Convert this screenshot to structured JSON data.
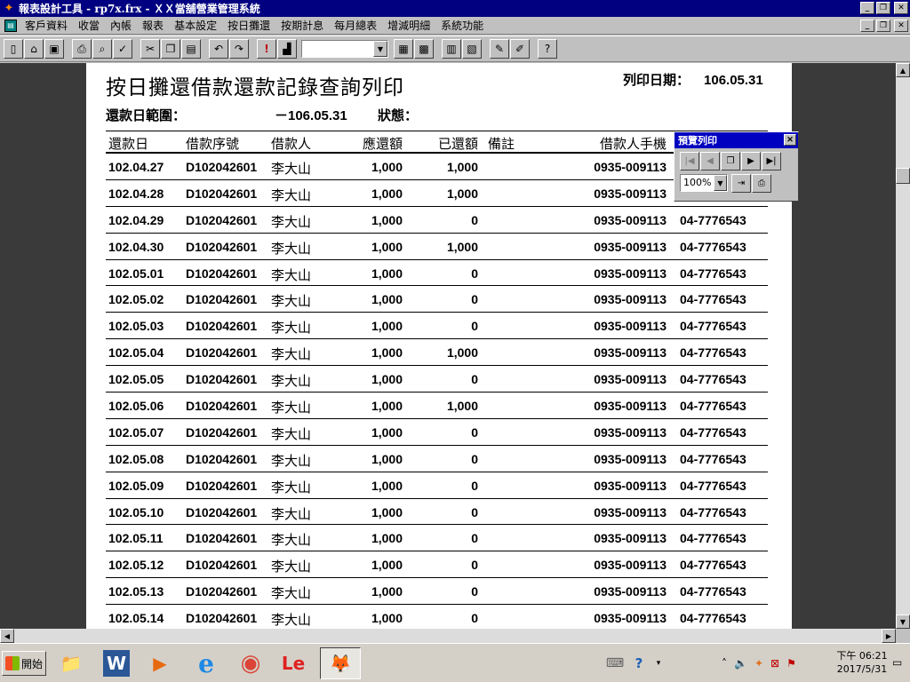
{
  "window": {
    "title": "報表設計工具 - rp7x.frx - ＸＸ當舖營業管理系統",
    "buttons": {
      "minimize": "_",
      "restore": "❐",
      "close": "✕"
    }
  },
  "menu": {
    "items": [
      "客戶資料",
      "收當",
      "內帳",
      "報表",
      "基本設定",
      "按日攤還",
      "按期計息",
      "每月總表",
      "增減明細",
      "系統功能"
    ]
  },
  "toolbar": {
    "icons": [
      "new-icon",
      "open-icon",
      "save-icon",
      "print-icon",
      "print-preview-icon",
      "spellcheck-icon",
      "cut-icon",
      "copy-icon",
      "paste-icon",
      "undo-icon",
      "redo-icon",
      "exclamation-icon",
      "chart-icon",
      "table-icon",
      "form-icon",
      "report-icon",
      "query-icon",
      "edit-icon",
      "wizard-icon",
      "help-icon"
    ],
    "combo_value": ""
  },
  "report": {
    "title": "按日攤還借款還款記錄查詢列印",
    "print_date_label": "列印日期：",
    "print_date": "106.05.31",
    "range_label": "還款日範圍：",
    "range_value": "－106.05.31",
    "status_label": "狀態：",
    "columns": {
      "date": "還款日",
      "loan_no": "借款序號",
      "borrower": "借款人",
      "due": "應還額",
      "paid": "已還額",
      "note": "備註",
      "mobile": "借款人手機"
    },
    "rows": [
      {
        "date": "102.04.27",
        "loan_no": "D102042601",
        "borrower": "李大山",
        "due": "1,000",
        "paid": "1,000",
        "mobile": "0935-009113",
        "phone": ""
      },
      {
        "date": "102.04.28",
        "loan_no": "D102042601",
        "borrower": "李大山",
        "due": "1,000",
        "paid": "1,000",
        "mobile": "0935-009113",
        "phone": ""
      },
      {
        "date": "102.04.29",
        "loan_no": "D102042601",
        "borrower": "李大山",
        "due": "1,000",
        "paid": "0",
        "mobile": "0935-009113",
        "phone": "04-7776543"
      },
      {
        "date": "102.04.30",
        "loan_no": "D102042601",
        "borrower": "李大山",
        "due": "1,000",
        "paid": "1,000",
        "mobile": "0935-009113",
        "phone": "04-7776543"
      },
      {
        "date": "102.05.01",
        "loan_no": "D102042601",
        "borrower": "李大山",
        "due": "1,000",
        "paid": "0",
        "mobile": "0935-009113",
        "phone": "04-7776543"
      },
      {
        "date": "102.05.02",
        "loan_no": "D102042601",
        "borrower": "李大山",
        "due": "1,000",
        "paid": "0",
        "mobile": "0935-009113",
        "phone": "04-7776543"
      },
      {
        "date": "102.05.03",
        "loan_no": "D102042601",
        "borrower": "李大山",
        "due": "1,000",
        "paid": "0",
        "mobile": "0935-009113",
        "phone": "04-7776543"
      },
      {
        "date": "102.05.04",
        "loan_no": "D102042601",
        "borrower": "李大山",
        "due": "1,000",
        "paid": "1,000",
        "mobile": "0935-009113",
        "phone": "04-7776543"
      },
      {
        "date": "102.05.05",
        "loan_no": "D102042601",
        "borrower": "李大山",
        "due": "1,000",
        "paid": "0",
        "mobile": "0935-009113",
        "phone": "04-7776543"
      },
      {
        "date": "102.05.06",
        "loan_no": "D102042601",
        "borrower": "李大山",
        "due": "1,000",
        "paid": "1,000",
        "mobile": "0935-009113",
        "phone": "04-7776543"
      },
      {
        "date": "102.05.07",
        "loan_no": "D102042601",
        "borrower": "李大山",
        "due": "1,000",
        "paid": "0",
        "mobile": "0935-009113",
        "phone": "04-7776543"
      },
      {
        "date": "102.05.08",
        "loan_no": "D102042601",
        "borrower": "李大山",
        "due": "1,000",
        "paid": "0",
        "mobile": "0935-009113",
        "phone": "04-7776543"
      },
      {
        "date": "102.05.09",
        "loan_no": "D102042601",
        "borrower": "李大山",
        "due": "1,000",
        "paid": "0",
        "mobile": "0935-009113",
        "phone": "04-7776543"
      },
      {
        "date": "102.05.10",
        "loan_no": "D102042601",
        "borrower": "李大山",
        "due": "1,000",
        "paid": "0",
        "mobile": "0935-009113",
        "phone": "04-7776543"
      },
      {
        "date": "102.05.11",
        "loan_no": "D102042601",
        "borrower": "李大山",
        "due": "1,000",
        "paid": "0",
        "mobile": "0935-009113",
        "phone": "04-7776543"
      },
      {
        "date": "102.05.12",
        "loan_no": "D102042601",
        "borrower": "李大山",
        "due": "1,000",
        "paid": "0",
        "mobile": "0935-009113",
        "phone": "04-7776543"
      },
      {
        "date": "102.05.13",
        "loan_no": "D102042601",
        "borrower": "李大山",
        "due": "1,000",
        "paid": "0",
        "mobile": "0935-009113",
        "phone": "04-7776543"
      },
      {
        "date": "102.05.14",
        "loan_no": "D102042601",
        "borrower": "李大山",
        "due": "1,000",
        "paid": "0",
        "mobile": "0935-009113",
        "phone": "04-7776543"
      }
    ]
  },
  "preview_toolbar": {
    "title": "預覽列印",
    "close": "✕",
    "zoom": "100%"
  },
  "taskbar": {
    "start_label": "開始",
    "apps": [
      {
        "name": "file-explorer-icon",
        "glyph": "📁"
      },
      {
        "name": "word-icon",
        "glyph": "W"
      },
      {
        "name": "media-player-icon",
        "glyph": "▶"
      },
      {
        "name": "internet-explorer-icon",
        "glyph": "e"
      },
      {
        "name": "chrome-icon",
        "glyph": "◉"
      },
      {
        "name": "le-icon",
        "glyph": "Le"
      },
      {
        "name": "fox-app-icon",
        "glyph": "🦊"
      }
    ],
    "clock_period": "下午 06:21",
    "clock_date": "2017/5/31"
  }
}
